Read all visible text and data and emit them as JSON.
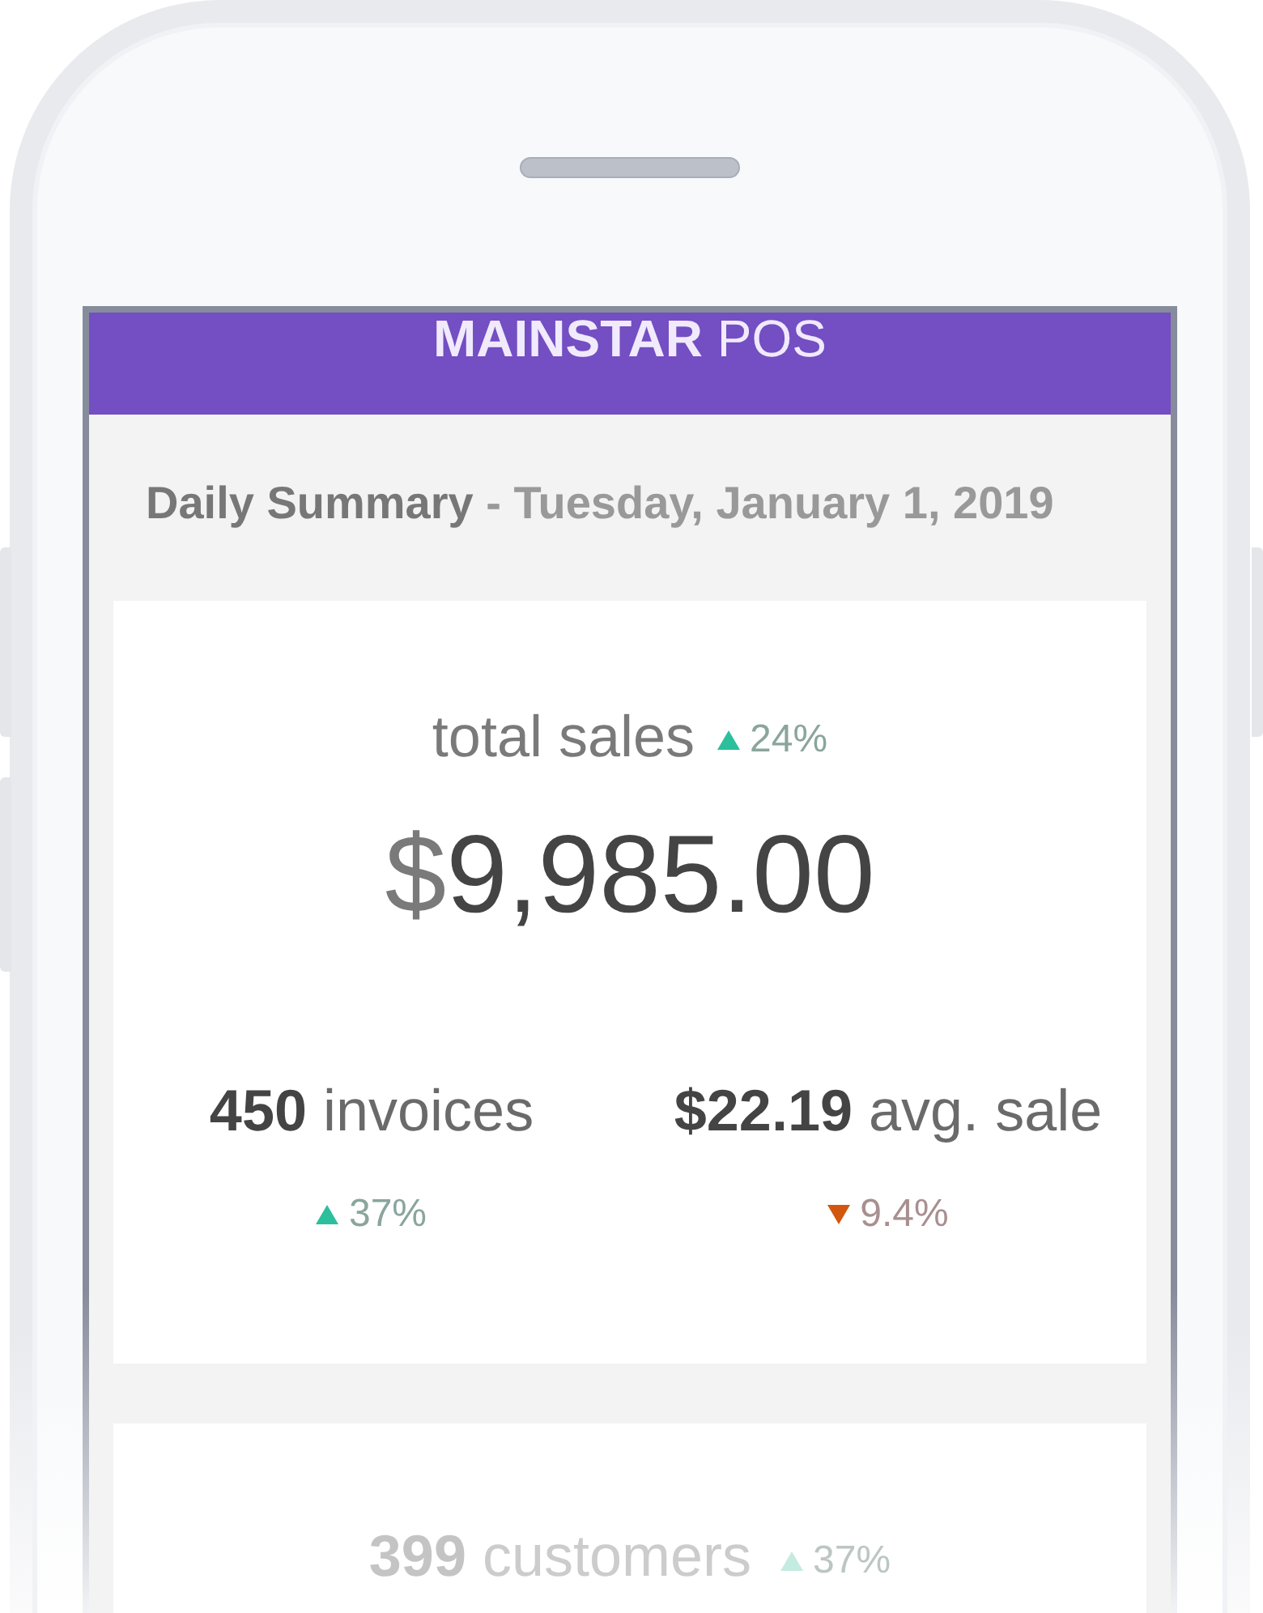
{
  "header": {
    "title": "**MAINSTAR** POS"
  },
  "summary": {
    "title": "Daily Summary",
    "date": "- Tuesday, January 1, 2019"
  },
  "cards": [
    {
      "kind": "total",
      "faded": false,
      "label": "total sales",
      "change": {
        "up": true,
        "value": "24%"
      },
      "currency": "$",
      "amount": "9,985.00",
      "stats": [
        {
          "value": "450",
          "label": "invoices",
          "change": {
            "up": true,
            "value": "37%"
          }
        },
        {
          "value": "$22.19",
          "label": "avg. sale",
          "change": {
            "up": false,
            "value": "9.4%"
          }
        }
      ]
    },
    {
      "kind": "stat",
      "faded": true,
      "value": "399",
      "label": "customers",
      "change": {
        "up": true,
        "value": "37%"
      }
    }
  ]
}
